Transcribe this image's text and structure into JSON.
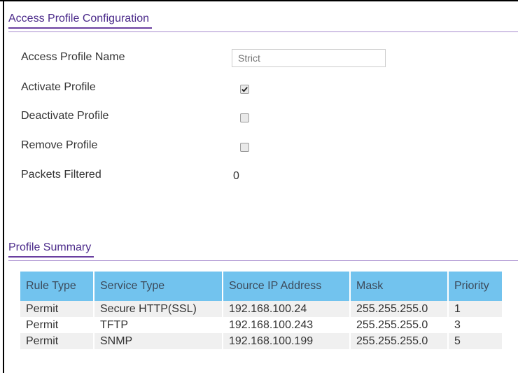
{
  "config_section": {
    "title": "Access Profile Configuration"
  },
  "fields": {
    "name_label": "Access Profile Name",
    "name_placeholder": "Strict",
    "activate_label": "Activate Profile",
    "activate_checked": true,
    "deactivate_label": "Deactivate Profile",
    "deactivate_checked": false,
    "remove_label": "Remove Profile",
    "remove_checked": false,
    "packets_label": "Packets Filtered",
    "packets_value": "0"
  },
  "summary_section": {
    "title": "Profile Summary"
  },
  "summary_table": {
    "headers": [
      "Rule Type",
      "Service Type",
      "Source IP Address",
      "Mask",
      "Priority"
    ],
    "rows": [
      [
        "Permit",
        "Secure HTTP(SSL)",
        "192.168.100.24",
        "255.255.255.0",
        "1"
      ],
      [
        "Permit",
        "TFTP",
        "192.168.100.243",
        "255.255.255.0",
        "3"
      ],
      [
        "Permit",
        "SNMP",
        "192.168.100.199",
        "255.255.255.0",
        "5"
      ]
    ]
  },
  "colors": {
    "section_title": "#4b2a8a",
    "section_rule": "#a78ccf",
    "table_header_bg": "#72c3ee",
    "table_row_alt": "#f0f0f0"
  }
}
